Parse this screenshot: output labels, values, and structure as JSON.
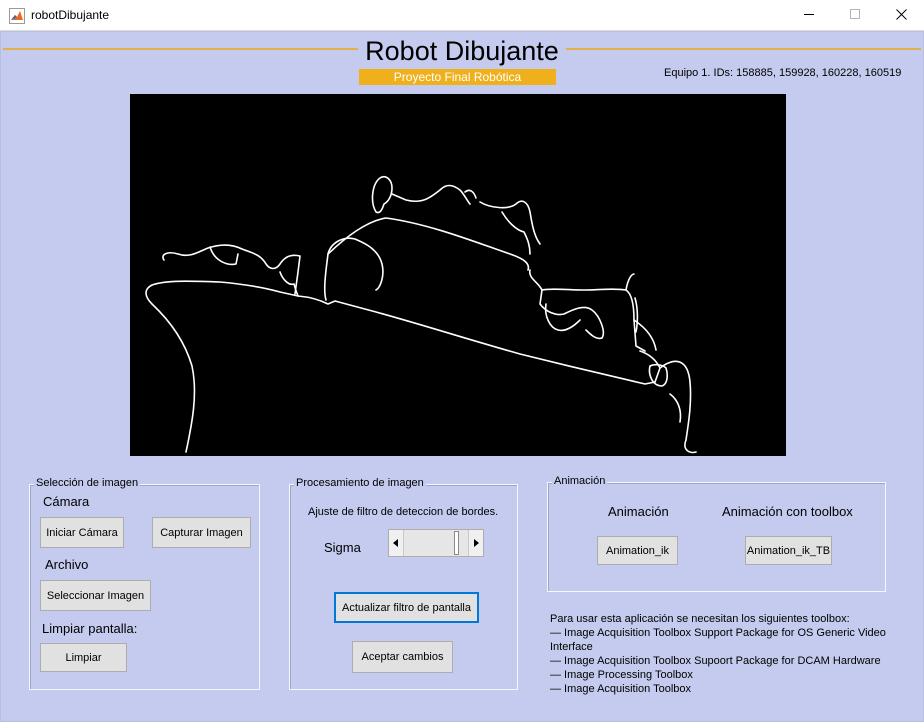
{
  "window": {
    "title": "robotDibujante",
    "minimize_icon": "minimize-icon",
    "maximize_icon": "maximize-icon",
    "close_icon": "close-icon"
  },
  "header": {
    "title": "Robot Dibujante",
    "subtitle": "Proyecto Final Robótica",
    "team": "Equipo 1. IDs: 158885, 159928, 160228, 160519",
    "accent_color": "#efb01c",
    "background_color": "#c4cbee"
  },
  "image_panel": {
    "title": "Selección de imagen",
    "camera_label": "Cámara",
    "start_camera_button": "Iniciar Cámara",
    "capture_button": "Capturar Imagen",
    "file_label": "Archivo",
    "select_button": "Seleccionar Imagen",
    "clear_label": "Limpiar pantalla:",
    "clear_button": "Limpiar"
  },
  "processing_panel": {
    "title": "Procesamiento de imagen",
    "description": "Ajuste de filtro de deteccion de bordes.",
    "sigma_label": "Sigma",
    "slider_value": 0.85,
    "update_button": "Actualizar filtro de pantalla",
    "accept_button": "Aceptar cambios"
  },
  "animation_panel": {
    "title": "Animación",
    "animation_label": "Animación",
    "animation_toolbox_label": "Animación con toolbox",
    "animation_button": "Animation_ik",
    "animation_tb_button": "Animation_ik_TB"
  },
  "info": {
    "intro": "Para usar esta aplicación se necesitan los siguientes toolbox:",
    "items": [
      "— Image Acquisition Toolbox Support Package for OS Generic Video Interface",
      "— Image Acquisition Toolbox Supoort Package for DCAM Hardware",
      "— Image Processing Toolbox",
      "— Image Acquisition Toolbox"
    ]
  }
}
